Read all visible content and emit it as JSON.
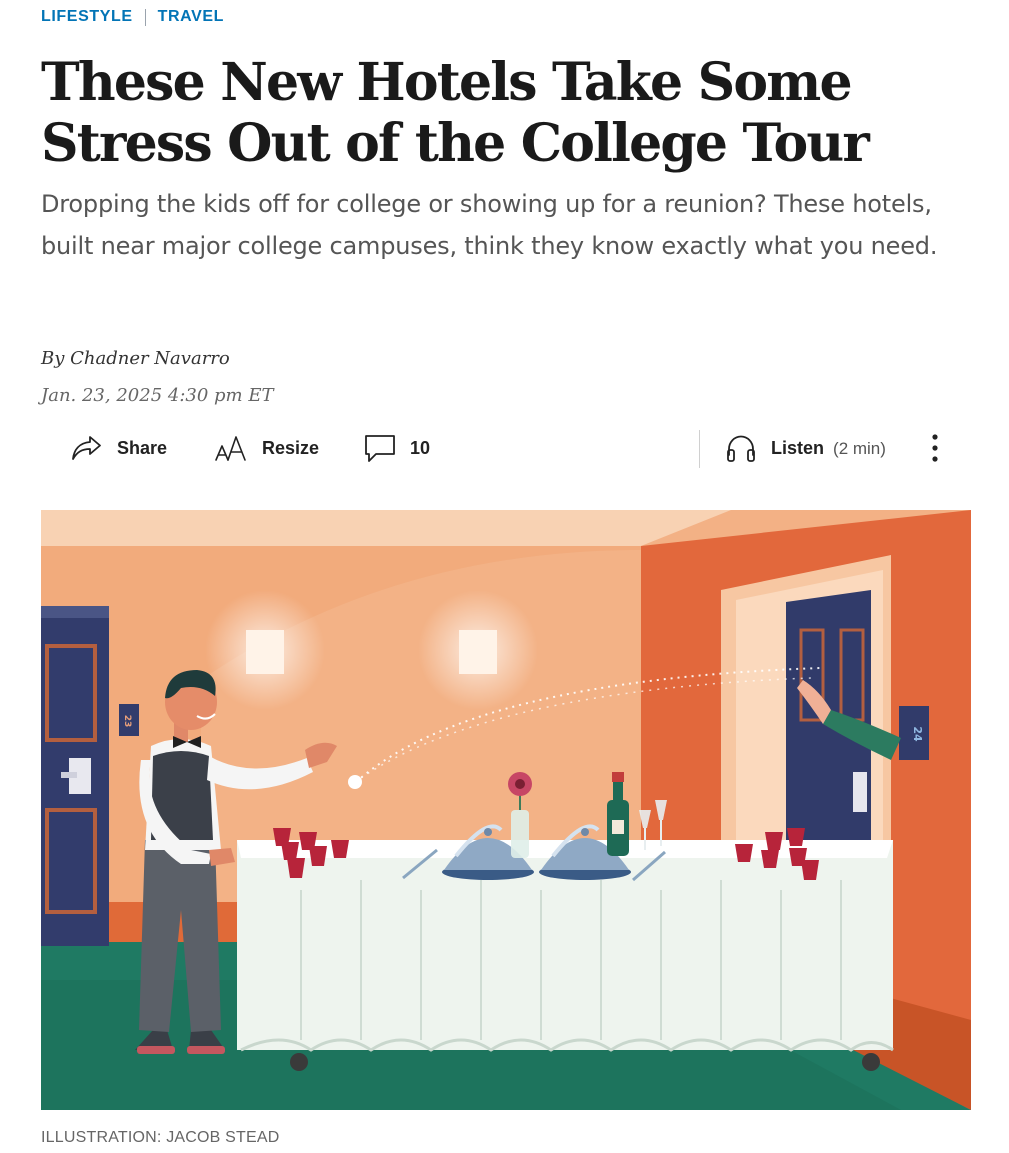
{
  "breadcrumb": {
    "section": "LIFESTYLE",
    "subsection": "TRAVEL"
  },
  "headline": "These New Hotels Take Some Stress Out of the College Tour",
  "dek": "Dropping the kids off for college or showing up for a reunion? These hotels, built near major college campuses, think they know exactly what you need.",
  "byline": "By Chadner Navarro",
  "timestamp": "Jan. 23, 2025 4:30 pm ET",
  "toolbar": {
    "share_label": "Share",
    "resize_label": "Resize",
    "comment_count": "10",
    "listen_label": "Listen",
    "listen_duration": "(2 min)",
    "share_icon": "share-arrow-icon",
    "resize_icon": "text-resize-icon",
    "comment_icon": "speech-bubble-icon",
    "listen_icon": "headphones-icon",
    "more_icon": "vertical-ellipsis-icon"
  },
  "figure": {
    "room_numbers": {
      "left_door": "23",
      "right_door": "24"
    },
    "credit": "ILLUSTRATION: JACOB STEAD"
  },
  "colors": {
    "link_blue": "#0274b6",
    "wall_peach": "#f2ab7c",
    "wall_orange": "#e2683c",
    "carpet_green": "#1f7a63",
    "door_navy": "#313b6a",
    "cup_red": "#b7243a"
  }
}
